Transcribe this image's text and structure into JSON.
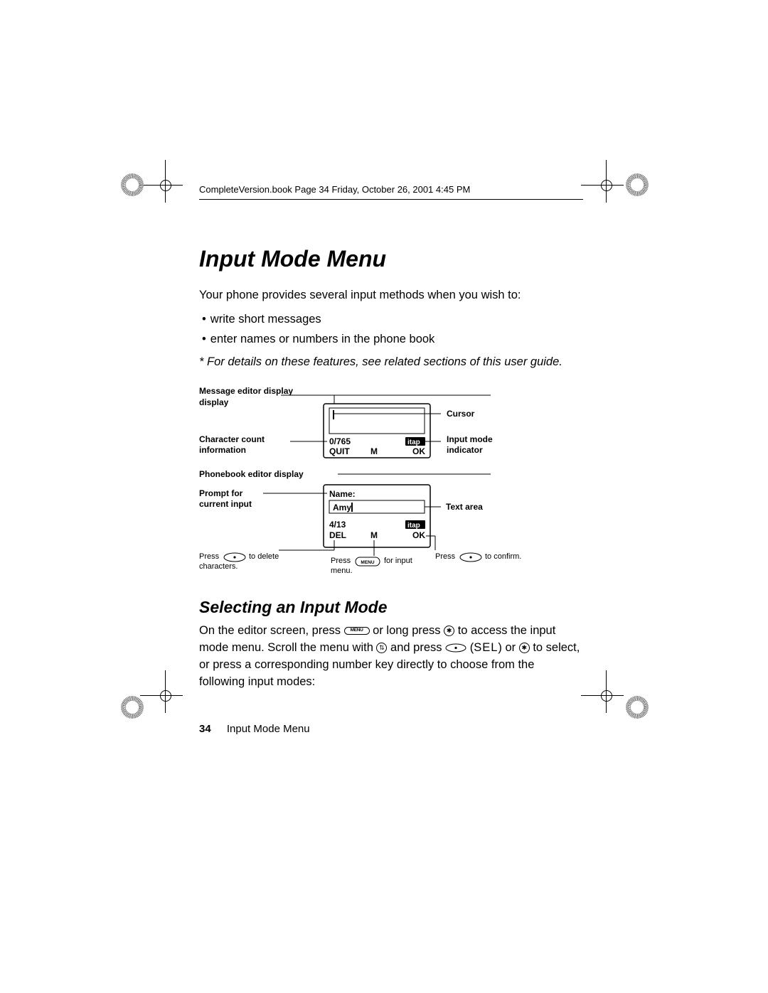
{
  "meta_line": "CompleteVersion.book  Page 34  Friday, October 26, 2001  4:45 PM",
  "title": "Input Mode Menu",
  "intro": "Your phone provides several input methods when you wish to:",
  "bullets": [
    "write short messages",
    "enter names or numbers in the phone book"
  ],
  "note": "* For details on these features, see related sections of this user guide.",
  "diagram": {
    "msg_editor": {
      "heading": "Message editor display",
      "char_count_label": "Character count information",
      "cursor_label": "Cursor",
      "input_mode_label": "Input mode indicator",
      "char_count_value": "0/765",
      "softkeys": {
        "left": "QUIT",
        "mid": "M",
        "right": "OK"
      },
      "mode_indicator": "itap"
    },
    "pb_editor": {
      "heading": "Phonebook editor display",
      "prompt_label": "Prompt for current input",
      "text_area_label": "Text area",
      "field_prompt": "Name:",
      "field_value": "Amy",
      "count_value": "4/13",
      "softkeys": {
        "left": "DEL",
        "mid": "M",
        "right": "OK"
      },
      "mode_indicator": "itap",
      "foot_left_pre": "Press",
      "foot_left_post": "to delete characters.",
      "foot_mid_pre": "Press",
      "foot_mid_post": "for input menu.",
      "foot_right_pre": "Press",
      "foot_right_post": "to confirm."
    }
  },
  "subhead": "Selecting an Input Mode",
  "para_parts": {
    "p1a": "On the editor screen, press ",
    "p1b": " or long press ",
    "p1c": " to access the input mode menu. Scroll the menu with ",
    "p1d": " and press ",
    "p1e": " (",
    "sel": "SEL",
    "p1f": ") or ",
    "p1g": " to select, or press a corresponding number key directly to choose from the following input modes:"
  },
  "keys": {
    "menu": "MENU"
  },
  "footer": {
    "page": "34",
    "section": "Input Mode Menu"
  }
}
